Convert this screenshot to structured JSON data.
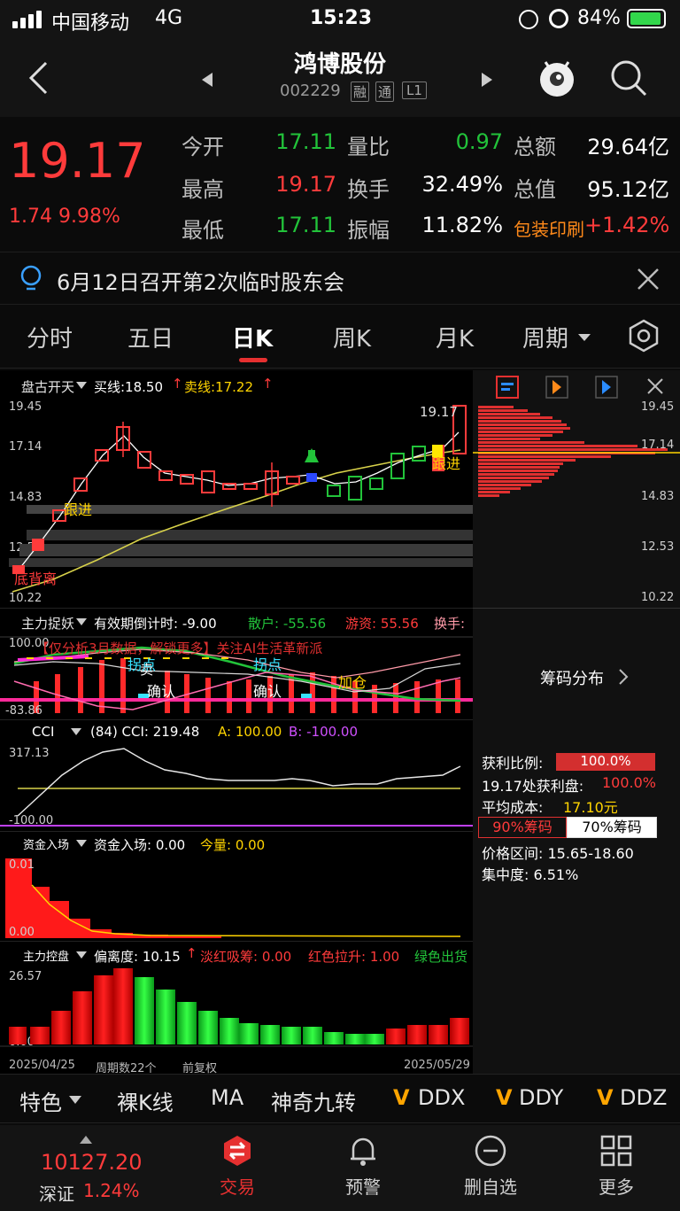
{
  "status_bar": {
    "carrier": "中国移动",
    "network": "4G",
    "time": "15:23",
    "battery": "84%"
  },
  "header": {
    "stock_name": "鸿博股份",
    "stock_code": "002229",
    "badges": [
      "融",
      "通",
      "L1"
    ]
  },
  "quote": {
    "price": "19.17",
    "change": "1.74",
    "change_pct": "9.98%",
    "rows": [
      {
        "l1": "今开",
        "v1": "17.11",
        "l2": "量比",
        "v2": "0.97",
        "l3": "总额",
        "v3": "29.64亿"
      },
      {
        "l1": "最高",
        "v1": "19.17",
        "l2": "换手",
        "v2": "32.49%",
        "l3": "总值",
        "v3": "95.12亿"
      },
      {
        "l1": "最低",
        "v1": "17.11",
        "l2": "振幅",
        "v2": "11.82%",
        "l3": "包装印刷",
        "v3": "+1.42%"
      }
    ]
  },
  "notice": {
    "text": "6月12日召开第2次临时股东会"
  },
  "tabs": [
    "分时",
    "五日",
    "日K",
    "周K",
    "月K",
    "周期"
  ],
  "kline_panel": {
    "indicator_name": "盘古开天",
    "buy_line": "买线:18.50",
    "sell_line": "卖线:17.22",
    "y_labels": [
      "19.45",
      "17.14",
      "14.83",
      "12.53",
      "10.22"
    ],
    "price_high_label": "19.17",
    "annotations": {
      "follow1": "跟进",
      "follow2": "跟进",
      "divergence": "底背离"
    }
  },
  "chip_panel": {
    "y_labels": [
      "19.45",
      "17.14",
      "14.83",
      "12.53",
      "10.22"
    ],
    "title": "筹码分布",
    "profit_ratio_label": "获利比例:",
    "profit_ratio": "100.0%",
    "profit_at_label": "19.17处获利盘:",
    "profit_at": "100.0%",
    "avg_cost_label": "平均成本:",
    "avg_cost": "17.10元",
    "btn90": "90%筹码",
    "btn70": "70%筹码",
    "range": "价格区间: 15.65-18.60",
    "concentration": "集中度: 6.51%"
  },
  "indicator2": {
    "name": "主力捉妖",
    "countdown": "有效期倒计时: -9.00",
    "retail": "散户: -55.56",
    "hot": "游资: 55.56",
    "turnover": "换手:",
    "y_top": "100.00",
    "y_bottom": "-83.86",
    "promo": "【仅分析3月数据，解锁更多】关注AI生活革新派",
    "labels": {
      "sell": "卖",
      "turn1": "拐点",
      "turn2": "拐点",
      "confirm1": "确认",
      "confirm2": "确认",
      "add": "加仓"
    }
  },
  "cci": {
    "name": "CCI",
    "params": "(84) CCI: 219.48",
    "a": "A: 100.00",
    "b": "B: -100.00",
    "y_top": "317.13",
    "y_bottom": "-100.00"
  },
  "fund": {
    "name": "资金入场",
    "entry": "资金入场: 0.00",
    "today": "今量: 0.00",
    "y_top": "0.01",
    "y_bottom": "0.00"
  },
  "control": {
    "name": "主力控盘",
    "deviation": "偏离度: 10.15",
    "light_red": "淡红吸筹: 0.00",
    "red_rise": "红色拉升: 1.00",
    "green_out": "绿色出货",
    "y_top": "26.57",
    "y_bottom": "0.00"
  },
  "footer_axis": {
    "start_date": "2025/04/25",
    "period_count": "周期数22个",
    "adjust": "前复权",
    "end_date": "2025/05/29"
  },
  "features": [
    "特色",
    "裸K线",
    "MA",
    "神奇九转",
    "DDX",
    "DDY",
    "DDZ"
  ],
  "bottom_nav": {
    "index_value": "10127.20",
    "index_name": "深证",
    "index_pct": "1.24%",
    "items": [
      "交易",
      "预警",
      "删自选",
      "更多"
    ]
  },
  "colors": {
    "up": "#ff3b3b",
    "down": "#22c33a",
    "accent": "#e63030"
  }
}
